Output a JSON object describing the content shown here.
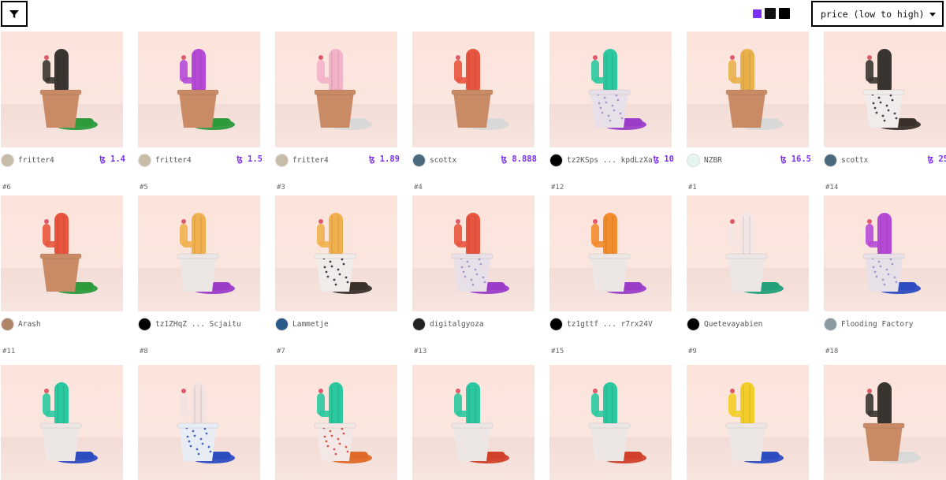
{
  "toolbar": {
    "sort_label": "price (low to high)",
    "swatch_colors": [
      "#7b2ff7",
      "#111111",
      "#000000"
    ]
  },
  "cards": [
    {
      "owner": "fritter4",
      "price": "ꜩ 1.4",
      "next_id": "#6",
      "cactus": "#3a3530",
      "pot": "terracotta",
      "grass": "#2d9a3c",
      "avatar": "#c8bba8"
    },
    {
      "owner": "fritter4",
      "price": "ꜩ 1.5",
      "next_id": "#5",
      "cactus": "#b64ad6",
      "pot": "terracotta",
      "grass": "#2d9a3c",
      "avatar": "#c8bba8"
    },
    {
      "owner": "fritter4",
      "price": "ꜩ 1.89",
      "next_id": "#3",
      "cactus": "#f2b2c8",
      "pot": "terracotta",
      "grass": "#d8d8d8",
      "avatar": "#c8bba8"
    },
    {
      "owner": "scottx",
      "price": "ꜩ 8.888",
      "next_id": "#4",
      "cactus": "#e8553e",
      "pot": "terracotta",
      "grass": "#d8d8d8",
      "avatar": "#4b6a7d"
    },
    {
      "owner": "tz2KSps ... kpdLzXa",
      "price": "ꜩ 10",
      "next_id": "#12",
      "cactus": "#2cc8a0",
      "pot": "pattern",
      "grass": "#9a3cc8",
      "avatar": "#000000"
    },
    {
      "owner": "NZBR",
      "price": "ꜩ 16.5",
      "next_id": "#1",
      "cactus": "#eab04c",
      "pot": "terracotta",
      "grass": "#d8d8d8",
      "avatar": "#e8f4f0"
    },
    {
      "owner": "scottx",
      "price": "ꜩ 25",
      "next_id": "#14",
      "cactus": "#3a3530",
      "pot": "speckle",
      "grass": "#3a302a",
      "avatar": "#4b6a7d"
    },
    {
      "owner": "Arash",
      "price": "",
      "next_id": "#11",
      "cactus": "#e8553e",
      "pot": "terracotta",
      "grass": "#2d9a3c",
      "avatar": "#b08468"
    },
    {
      "owner": "tz1ZHqZ ... Scjaitu",
      "price": "",
      "next_id": "#8",
      "cactus": "#f1b04e",
      "pot": "white",
      "grass": "#9a3cc8",
      "avatar": "#000000"
    },
    {
      "owner": "Lammetje",
      "price": "",
      "next_id": "#7",
      "cactus": "#f1b04e",
      "pot": "speckle",
      "grass": "#3a302a",
      "avatar": "#2a5a8a"
    },
    {
      "owner": "digitalgyoza",
      "price": "",
      "next_id": "#13",
      "cactus": "#e8553e",
      "pot": "pattern",
      "grass": "#9a3cc8",
      "avatar": "#222222"
    },
    {
      "owner": "tz1gttf ... r7rx24V",
      "price": "",
      "next_id": "#15",
      "cactus": "#f28c2c",
      "pot": "white",
      "grass": "#9a3cc8",
      "avatar": "#000000"
    },
    {
      "owner": "Quetevayabien",
      "price": "",
      "next_id": "#9",
      "cactus": "#f4e6e4",
      "pot": "white",
      "grass": "#22a07a",
      "avatar": "#000000"
    },
    {
      "owner": "Flooding Factory",
      "price": "",
      "next_id": "#18",
      "cactus": "#b64ad6",
      "pot": "pattern",
      "grass": "#2c4cc0",
      "avatar": "#8a9aa0"
    },
    {
      "owner": "",
      "price": "",
      "next_id": "",
      "cactus": "#2cc8a0",
      "pot": "white",
      "grass": "#2c4cc0",
      "avatar": ""
    },
    {
      "owner": "",
      "price": "",
      "next_id": "",
      "cactus": "#f2e2e0",
      "pot": "blue-speckle",
      "grass": "#2c4cc0",
      "avatar": ""
    },
    {
      "owner": "",
      "price": "",
      "next_id": "",
      "cactus": "#2cc8a0",
      "pot": "red-speckle",
      "grass": "#e06a2a",
      "avatar": ""
    },
    {
      "owner": "",
      "price": "",
      "next_id": "",
      "cactus": "#2cc8a0",
      "pot": "white",
      "grass": "#d0402a",
      "avatar": ""
    },
    {
      "owner": "",
      "price": "",
      "next_id": "",
      "cactus": "#2cc8a0",
      "pot": "white",
      "grass": "#d0402a",
      "avatar": ""
    },
    {
      "owner": "",
      "price": "",
      "next_id": "",
      "cactus": "#f3cd28",
      "pot": "white",
      "grass": "#2c4cc0",
      "avatar": ""
    },
    {
      "owner": "",
      "price": "",
      "next_id": "",
      "cactus": "#3a3530",
      "pot": "terracotta",
      "grass": "#d8d8d8",
      "avatar": ""
    }
  ]
}
